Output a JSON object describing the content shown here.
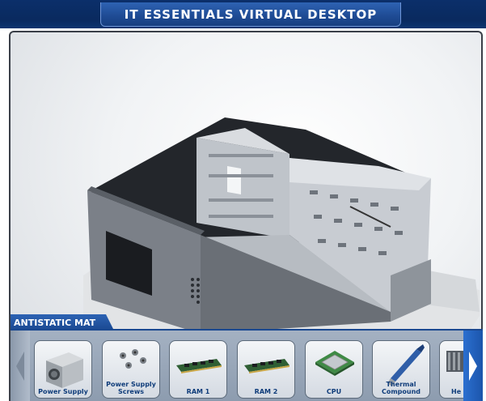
{
  "app": {
    "title": "IT ESSENTIALS VIRTUAL DESKTOP"
  },
  "workspace": {
    "mat_label": "ANTISTATIC MAT"
  },
  "components": [
    {
      "label": "Power Supply",
      "icon": "power-supply-icon"
    },
    {
      "label": "Power Supply Screws",
      "icon": "screws-icon"
    },
    {
      "label": "RAM 1",
      "icon": "ram-icon"
    },
    {
      "label": "RAM 2",
      "icon": "ram-icon"
    },
    {
      "label": "CPU",
      "icon": "cpu-icon"
    },
    {
      "label": "Thermal Compound",
      "icon": "thermal-compound-icon"
    },
    {
      "label": "He",
      "icon": "heatsink-icon"
    }
  ],
  "colors": {
    "title_bg": "#0a2a5f",
    "accent": "#1e4a93",
    "tray": "#9aa8ba"
  }
}
